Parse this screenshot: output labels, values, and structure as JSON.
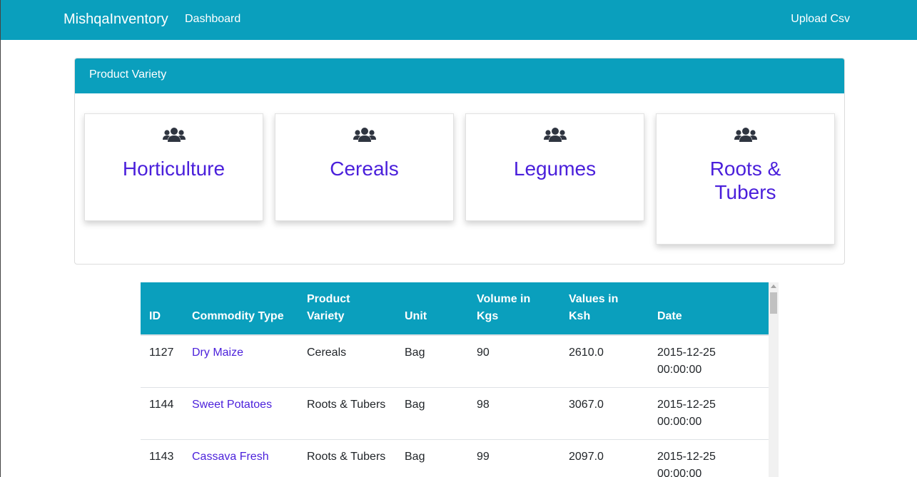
{
  "navbar": {
    "brand": "MishqaInventory",
    "dashboard_label": "Dashboard",
    "upload_label": "Upload Csv"
  },
  "panel": {
    "title": "Product Variety",
    "cards": [
      {
        "label": "Horticulture",
        "icon": "users-icon"
      },
      {
        "label": "Cereals",
        "icon": "users-icon"
      },
      {
        "label": "Legumes",
        "icon": "users-icon"
      },
      {
        "label": "Roots & Tubers",
        "icon": "users-icon"
      }
    ]
  },
  "table": {
    "headers": [
      "ID",
      "Commodity Type",
      "Product Variety",
      "Unit",
      "Volume in Kgs",
      "Values in Ksh",
      "Date"
    ],
    "rows": [
      [
        "1127",
        "Dry Maize",
        "Cereals",
        "Bag",
        "90",
        "2610.0",
        "2015-12-25 00:00:00"
      ],
      [
        "1144",
        "Sweet Potatoes",
        "Roots & Tubers",
        "Bag",
        "98",
        "3067.0",
        "2015-12-25 00:00:00"
      ],
      [
        "1143",
        "Cassava Fresh",
        "Roots & Tubers",
        "Bag",
        "99",
        "2097.0",
        "2015-12-25 00:00:00"
      ]
    ]
  },
  "colors": {
    "primary": "#0a9fbd",
    "link": "#4a1fdb"
  }
}
